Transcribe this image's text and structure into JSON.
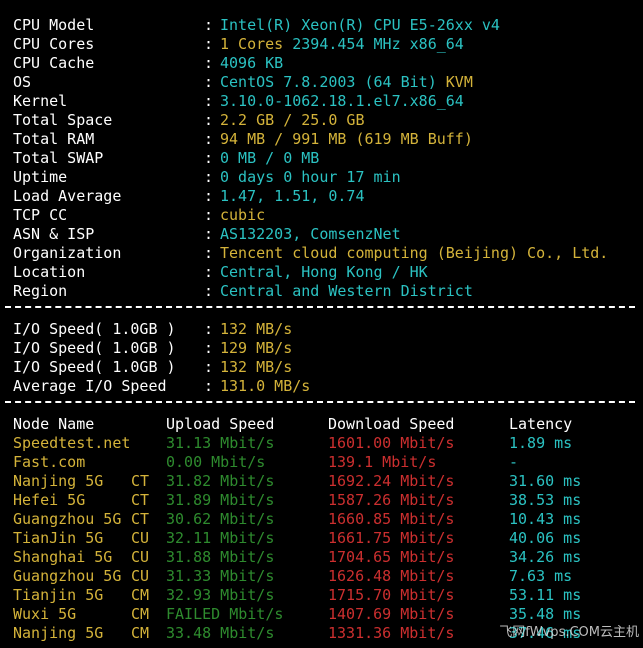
{
  "sysinfo": [
    {
      "label": "CPU Model",
      "value": "Intel(R) Xeon(R) CPU E5-26xx v4",
      "color": "cyan"
    },
    {
      "label": "CPU Cores",
      "value": "1 Cores 2394.454 MHz x86_64",
      "color": "cyan",
      "value_parts": [
        {
          "text": "1 Cores ",
          "color": "yellow"
        },
        {
          "text": "2394.454 MHz x86_64",
          "color": "cyan"
        }
      ]
    },
    {
      "label": "CPU Cache",
      "value": "4096 KB",
      "color": "cyan"
    },
    {
      "label": "OS",
      "value": "CentOS 7.8.2003 (64 Bit) KVM",
      "value_parts": [
        {
          "text": "CentOS 7.8.2003 (64 Bit) ",
          "color": "cyan"
        },
        {
          "text": "KVM",
          "color": "yellow"
        }
      ]
    },
    {
      "label": "Kernel",
      "value": "3.10.0-1062.18.1.el7.x86_64",
      "color": "cyan"
    },
    {
      "label": "Total Space",
      "value": "2.2 GB / 25.0 GB",
      "color": "yellow"
    },
    {
      "label": "Total RAM",
      "value": "94 MB / 991 MB (619 MB Buff)",
      "color": "yellow"
    },
    {
      "label": "Total SWAP",
      "value": "0 MB / 0 MB",
      "color": "cyan"
    },
    {
      "label": "Uptime",
      "value": "0 days 0 hour 17 min",
      "color": "cyan"
    },
    {
      "label": "Load Average",
      "value": "1.47, 1.51, 0.74",
      "color": "cyan"
    },
    {
      "label": "TCP CC",
      "value": "cubic",
      "color": "yellow"
    },
    {
      "label": "ASN & ISP",
      "value": "AS132203, ComsenzNet",
      "color": "cyan"
    },
    {
      "label": "Organization",
      "value": "Tencent cloud computing (Beijing) Co., Ltd.",
      "color": "yellow"
    },
    {
      "label": "Location",
      "value": "Central, Hong Kong / HK",
      "color": "cyan"
    },
    {
      "label": "Region",
      "value": "Central and Western District",
      "color": "cyan"
    }
  ],
  "io": [
    {
      "label": "I/O Speed( 1.0GB )",
      "value": "132 MB/s"
    },
    {
      "label": "I/O Speed( 1.0GB )",
      "value": "129 MB/s"
    },
    {
      "label": "I/O Speed( 1.0GB )",
      "value": "132 MB/s"
    },
    {
      "label": "Average I/O Speed",
      "value": "131.0 MB/s"
    }
  ],
  "speed_headers": {
    "node": "Node Name",
    "upload": "Upload Speed",
    "download": "Download Speed",
    "latency": "Latency"
  },
  "speed_rows": [
    {
      "node": "Speedtest.net",
      "isp": "",
      "upload": "31.13 Mbit/s",
      "download": "1601.00 Mbit/s",
      "latency": "1.89 ms"
    },
    {
      "node": "Fast.com",
      "isp": "",
      "upload": "0.00 Mbit/s",
      "download": "139.1 Mbit/s",
      "latency": "-"
    },
    {
      "node": "Nanjing 5G",
      "isp": "CT",
      "upload": "31.82 Mbit/s",
      "download": "1692.24 Mbit/s",
      "latency": "31.60 ms"
    },
    {
      "node": "Hefei 5G",
      "isp": "CT",
      "upload": "31.89 Mbit/s",
      "download": "1587.26 Mbit/s",
      "latency": "38.53 ms"
    },
    {
      "node": "Guangzhou 5G",
      "isp": "CT",
      "upload": "30.62 Mbit/s",
      "download": "1660.85 Mbit/s",
      "latency": "10.43 ms"
    },
    {
      "node": "TianJin 5G",
      "isp": "CU",
      "upload": "32.11 Mbit/s",
      "download": "1661.75 Mbit/s",
      "latency": "40.06 ms"
    },
    {
      "node": "Shanghai 5G",
      "isp": "CU",
      "upload": "31.88 Mbit/s",
      "download": "1704.65 Mbit/s",
      "latency": "34.26 ms"
    },
    {
      "node": "Guangzhou 5G",
      "isp": "CU",
      "upload": "31.33 Mbit/s",
      "download": "1626.48 Mbit/s",
      "latency": "7.63 ms"
    },
    {
      "node": "Tianjin 5G",
      "isp": "CM",
      "upload": "32.93 Mbit/s",
      "download": "1715.70 Mbit/s",
      "latency": "53.11 ms"
    },
    {
      "node": "Wuxi 5G",
      "isp": "CM",
      "upload": "FAILED Mbit/s",
      "download": "1407.69 Mbit/s",
      "latency": "35.48 ms"
    },
    {
      "node": "Nanjing 5G",
      "isp": "CM",
      "upload": "33.48 Mbit/s",
      "download": "1331.36 Mbit/s",
      "latency": "37.46 ms"
    }
  ],
  "watermark": "飞网fWvps.COM云主机",
  "colors": {
    "background": "#000000",
    "cyan": "#2bc2c2",
    "yellow": "#d4b33a",
    "green": "#2e8b2e",
    "red": "#cc2f2f",
    "white": "#ffffff"
  }
}
